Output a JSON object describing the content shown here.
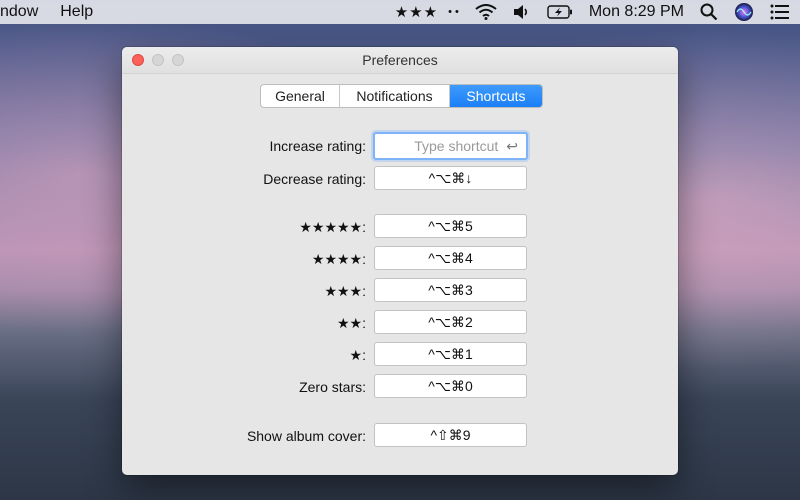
{
  "menubar": {
    "left_items": [
      "ndow",
      "Help"
    ],
    "stars": "★★★",
    "dots": "• •",
    "clock": "Mon 8:29 PM",
    "icons": [
      "wifi-icon",
      "volume-icon",
      "battery-charging-icon",
      "spotlight-search-icon",
      "siri-icon",
      "notification-center-icon"
    ]
  },
  "window": {
    "title": "Preferences",
    "tabs": [
      "General",
      "Notifications",
      "Shortcuts"
    ],
    "selected_tab": "Shortcuts",
    "accent": "#1b7ff6",
    "rows": [
      {
        "label": "Increase rating:",
        "placeholder": "Type shortcut",
        "value": "",
        "return_symbol": "↩"
      },
      {
        "label": "Decrease rating:",
        "value": "^⌥⌘↓"
      },
      {
        "label": "★★★★★:",
        "value": "^⌥⌘5"
      },
      {
        "label": "★★★★:",
        "value": "^⌥⌘4"
      },
      {
        "label": "★★★:",
        "value": "^⌥⌘3"
      },
      {
        "label": "★★:",
        "value": "^⌥⌘2"
      },
      {
        "label": "★:",
        "value": "^⌥⌘1"
      },
      {
        "label": "Zero stars:",
        "value": "^⌥⌘0"
      },
      {
        "label": "Show album cover:",
        "value": "^⇧⌘9"
      }
    ]
  }
}
